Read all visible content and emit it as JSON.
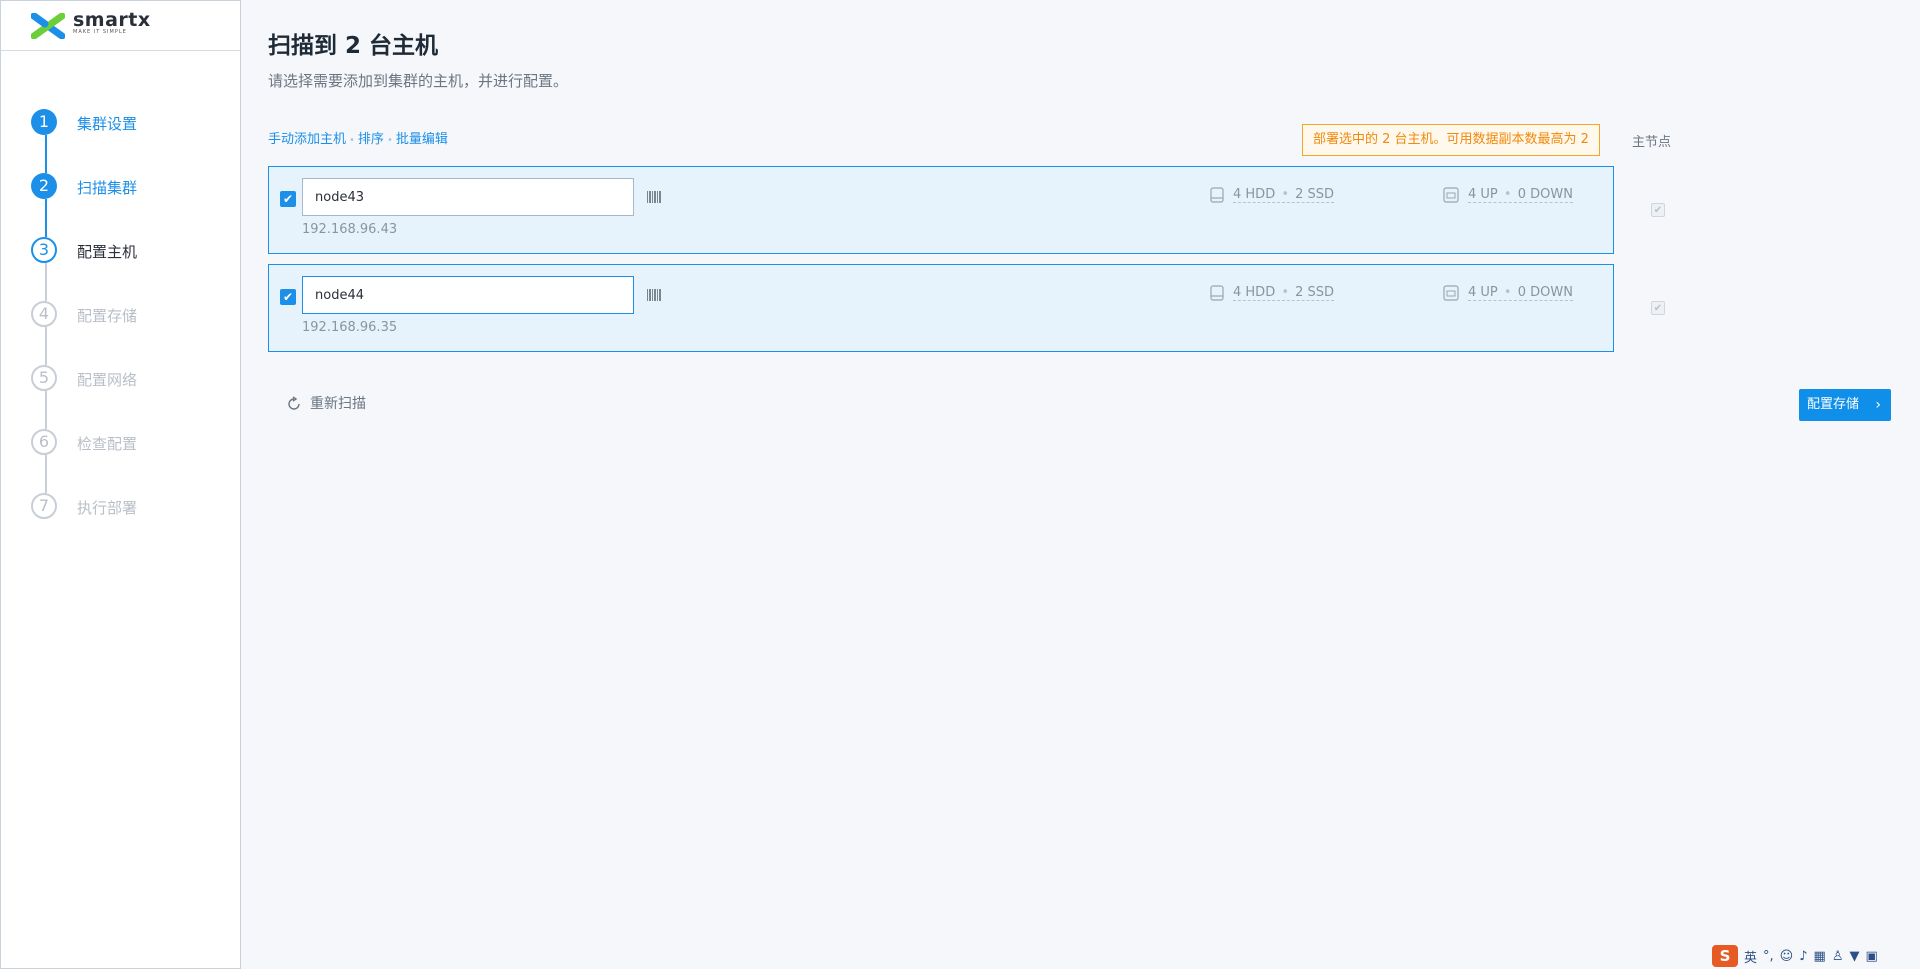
{
  "brand": {
    "name": "smartx",
    "tagline": "MAKE IT SIMPLE",
    "colors": {
      "primary": "#1c8fe8",
      "warning": "#f08a0e",
      "logo_blue": "#1c8fe8",
      "logo_green": "#6ccf3a"
    }
  },
  "steps": [
    {
      "number": "1",
      "label": "集群设置",
      "state": "done"
    },
    {
      "number": "2",
      "label": "扫描集群",
      "state": "done"
    },
    {
      "number": "3",
      "label": "配置主机",
      "state": "current"
    },
    {
      "number": "4",
      "label": "配置存储",
      "state": "todo"
    },
    {
      "number": "5",
      "label": "配置网络",
      "state": "todo"
    },
    {
      "number": "6",
      "label": "检查配置",
      "state": "todo"
    },
    {
      "number": "7",
      "label": "执行部署",
      "state": "todo"
    }
  ],
  "header": {
    "title": "扫描到 2 台主机",
    "subtitle": "请选择需要添加到集群的主机，并进行配置。"
  },
  "actions": {
    "add_host": "手动添加主机",
    "sort": "排序",
    "batch_edit": "批量编辑"
  },
  "warning": "部署选中的 2 台主机。可用数据副本数最高为 2",
  "master_column_label": "主节点",
  "hosts": [
    {
      "checked": true,
      "hostname": "node43",
      "ip": "192.168.96.43",
      "disk_hdd": "4 HDD",
      "disk_ssd": "2 SSD",
      "nic_up": "4 UP",
      "nic_down": "0 DOWN",
      "master_checked": true
    },
    {
      "checked": true,
      "hostname": "node44",
      "ip": "192.168.96.35",
      "disk_hdd": "4 HDD",
      "disk_ssd": "2 SSD",
      "nic_up": "4 UP",
      "nic_down": "0 DOWN",
      "master_checked": true
    }
  ],
  "footer": {
    "rescan": "重新扫描",
    "next": "配置存储"
  },
  "ime": {
    "logo": "S",
    "lang": "英"
  },
  "icons": {
    "check": "✔",
    "chevron": "›"
  }
}
